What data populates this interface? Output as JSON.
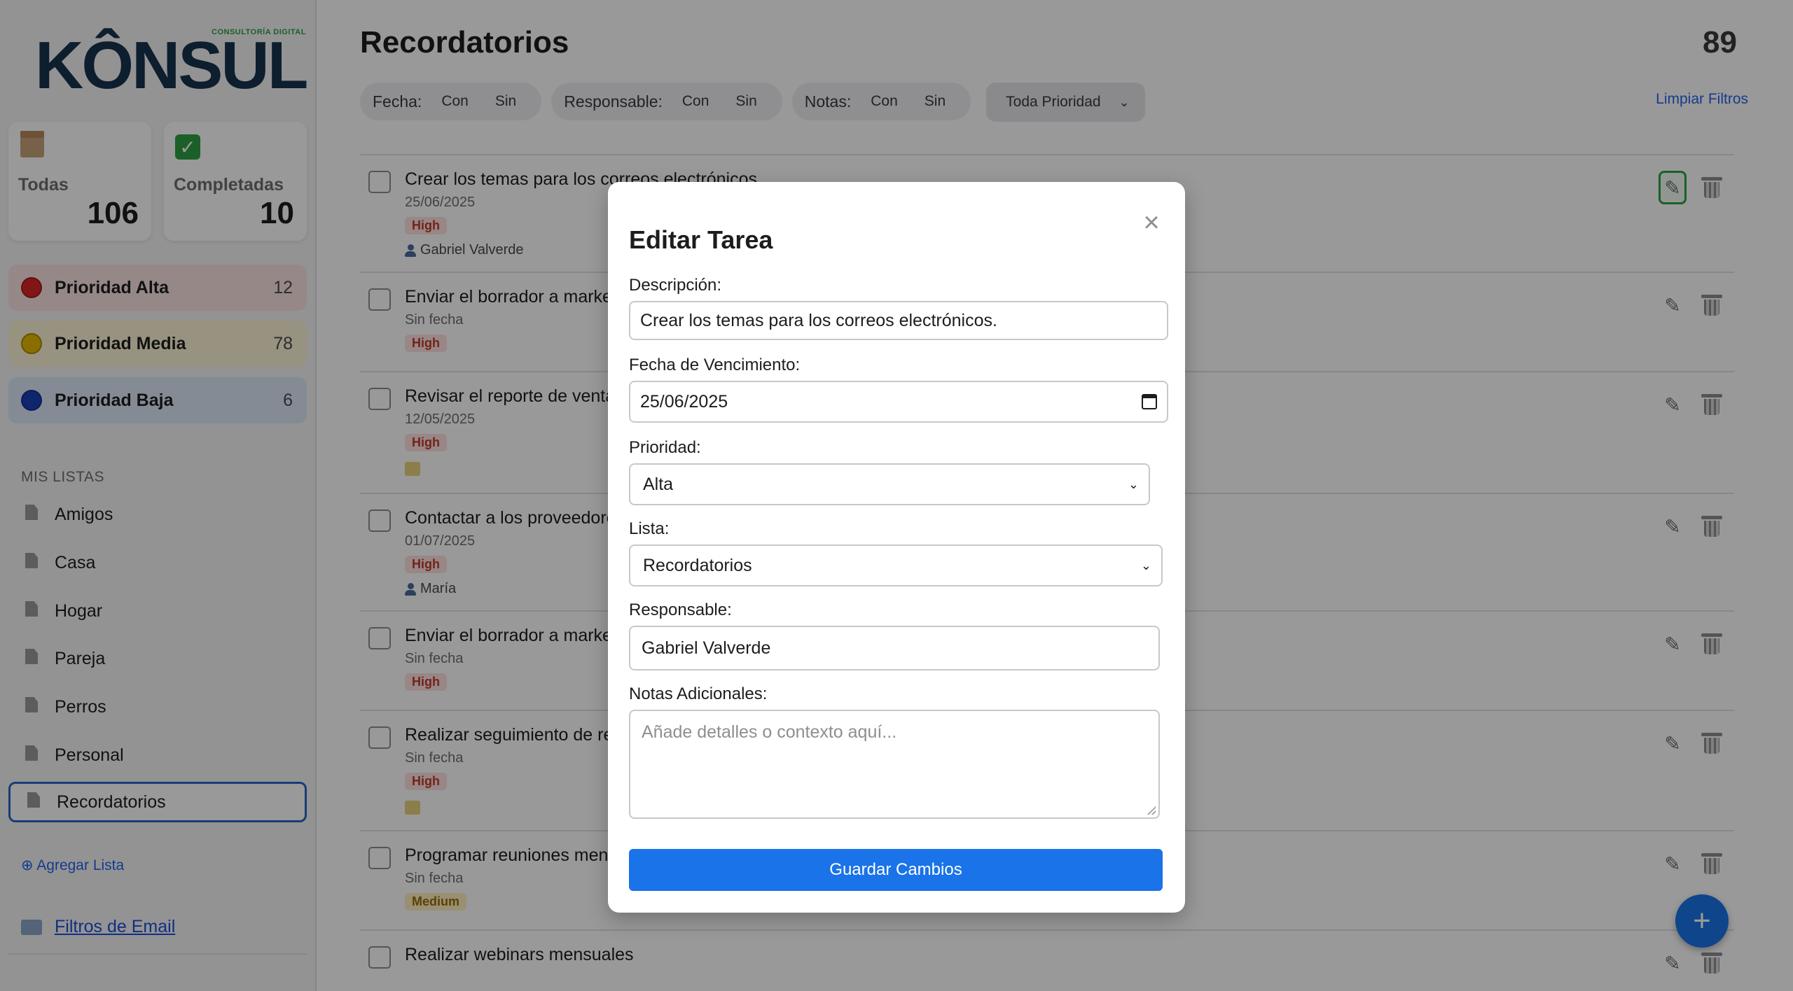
{
  "brand": {
    "logo_text": "KÔNSUL",
    "tagline": "CONSULTORÍA DIGITAL"
  },
  "stats": [
    {
      "label": "Todas",
      "count": "106",
      "icon": "box-icon"
    },
    {
      "label": "Completadas",
      "count": "10",
      "icon": "check-icon"
    }
  ],
  "priorities": [
    {
      "label": "Prioridad Alta",
      "count": "12",
      "color": "#d92626",
      "bg": "#fbe3e1"
    },
    {
      "label": "Prioridad Media",
      "count": "78",
      "color": "#e6b800",
      "bg": "#fdf3d6"
    },
    {
      "label": "Prioridad Baja",
      "count": "6",
      "color": "#1c3fb8",
      "bg": "#dce8f7"
    }
  ],
  "lists_title": "MIS LISTAS",
  "lists": [
    "Amigos",
    "Casa",
    "Hogar",
    "Pareja",
    "Perros",
    "Personal",
    "Recordatorios"
  ],
  "add_list": "⊕ Agregar Lista",
  "email_filters": "Filtros de Email",
  "header": {
    "title": "Recordatorios",
    "count": "89"
  },
  "filters": {
    "fecha_label": "Fecha:",
    "responsable_label": "Responsable:",
    "notas_label": "Notas:",
    "con": "Con",
    "sin": "Sin",
    "priority_select": "Toda Prioridad",
    "clear": "Limpiar Filtros"
  },
  "tasks": [
    {
      "title": "Crear los temas para los correos electrónicos.",
      "date": "25/06/2025",
      "badge": "High",
      "assignee": "Gabriel Valverde"
    },
    {
      "title": "Enviar el borrador a marketing",
      "date": "Sin fecha",
      "badge": "High"
    },
    {
      "title": "Revisar el reporte de ventas",
      "date": "12/05/2025",
      "badge": "High",
      "note": true
    },
    {
      "title": "Contactar a los proveedores",
      "date": "01/07/2025",
      "badge": "High",
      "assignee": "María"
    },
    {
      "title": "Enviar el borrador a marketing",
      "date": "Sin fecha",
      "badge": "High"
    },
    {
      "title": "Realizar seguimiento de reuniones",
      "date": "Sin fecha",
      "badge": "High",
      "note": true
    },
    {
      "title": "Programar reuniones mensuales",
      "date": "Sin fecha",
      "badge": "Medium"
    },
    {
      "title": "Realizar webinars mensuales"
    }
  ],
  "modal": {
    "title": "Editar Tarea",
    "close": "×",
    "desc_label": "Descripción:",
    "desc_value": "Crear los temas para los correos electrónicos.",
    "due_label": "Fecha de Vencimiento:",
    "due_value": "25/06/2025",
    "prio_label": "Prioridad:",
    "prio_value": "Alta",
    "list_label": "Lista:",
    "list_value": "Recordatorios",
    "resp_label": "Responsable:",
    "resp_value": "Gabriel Valverde",
    "notes_label": "Notas Adicionales:",
    "notes_placeholder": "Añade detalles o contexto aquí...",
    "save": "Guardar Cambios"
  },
  "fab": "+"
}
